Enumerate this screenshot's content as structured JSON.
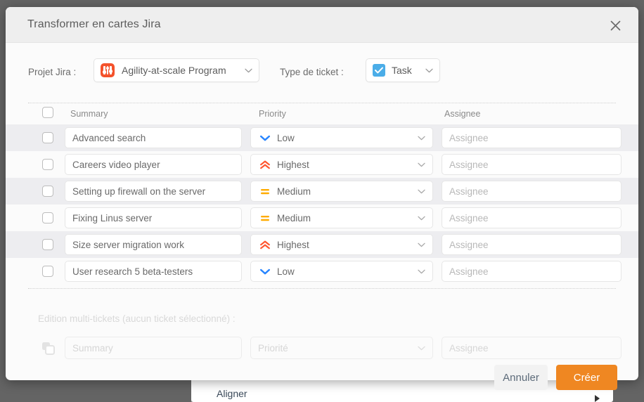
{
  "modal": {
    "title": "Transformer en cartes Jira",
    "close_icon": "close-icon"
  },
  "selectors": {
    "project_label": "Projet Jira :",
    "project_value": "Agility-at-scale Program",
    "project_icon": "jira-project-icon",
    "type_label": "Type de ticket :",
    "type_value": "Task",
    "type_icon": "jira-task-icon"
  },
  "table": {
    "headers": {
      "select_all": "select-all-checkbox",
      "summary": "Summary",
      "priority": "Priority",
      "assignee": "Assignee"
    },
    "assignee_placeholder": "Assignee",
    "rows": [
      {
        "summary": "Advanced search",
        "priority": "Low",
        "priority_icon": "priority-low-icon",
        "assignee": ""
      },
      {
        "summary": "Careers video player",
        "priority": "Highest",
        "priority_icon": "priority-highest-icon",
        "assignee": ""
      },
      {
        "summary": "Setting up firewall on the server",
        "priority": "Medium",
        "priority_icon": "priority-medium-icon",
        "assignee": ""
      },
      {
        "summary": "Fixing Linus server",
        "priority": "Medium",
        "priority_icon": "priority-medium-icon",
        "assignee": ""
      },
      {
        "summary": "Size server migration work",
        "priority": "Highest",
        "priority_icon": "priority-highest-icon",
        "assignee": ""
      },
      {
        "summary": "User research 5 beta-testers",
        "priority": "Low",
        "priority_icon": "priority-low-icon",
        "assignee": ""
      }
    ]
  },
  "multi_edit": {
    "label": "Edition multi-tickets (aucun ticket sélectionné) :",
    "copy_icon": "copy-icon",
    "summary_placeholder": "Summary",
    "priority_placeholder": "Priorité",
    "assignee_placeholder": "Assignee"
  },
  "footer": {
    "cancel_label": "Annuler",
    "create_label": "Créer"
  },
  "background": {
    "card_label": "Aligner"
  },
  "colors": {
    "accent_orange": "#ef8722",
    "project_icon": "#f4522b",
    "task_icon": "#4bade8",
    "priority_low": "#2684ff",
    "priority_medium": "#ffab00",
    "priority_highest": "#ff5630",
    "modal_bg": "#fbfbfb",
    "header_bg": "#eeeeee",
    "row_alt_bg": "#ededf0",
    "overlay": "#646464"
  }
}
